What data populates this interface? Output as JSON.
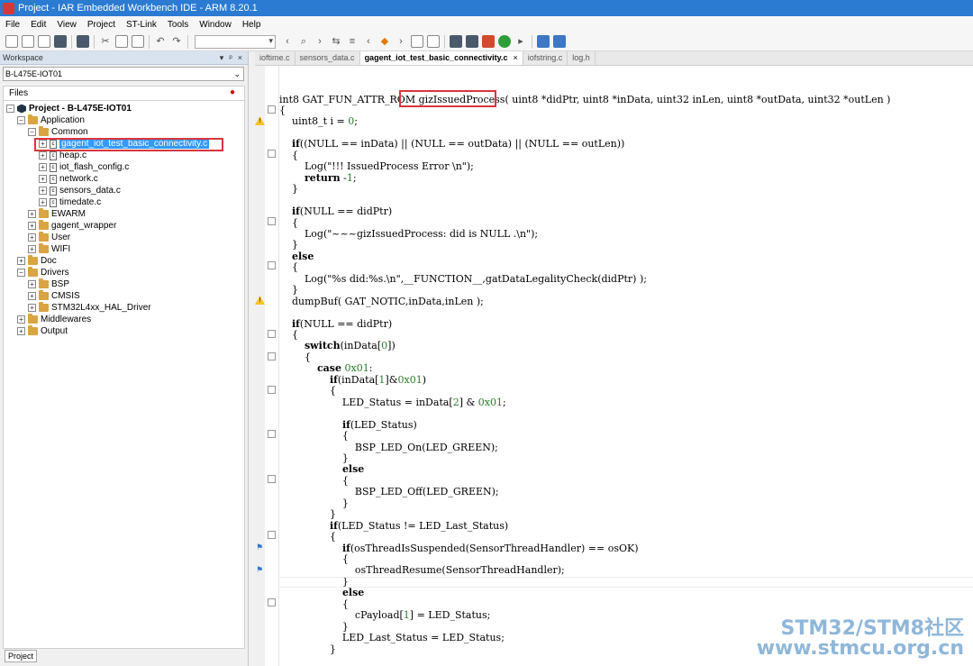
{
  "window": {
    "title": "Project - IAR Embedded Workbench IDE - ARM 8.20.1"
  },
  "menu": [
    "File",
    "Edit",
    "View",
    "Project",
    "ST-Link",
    "Tools",
    "Window",
    "Help"
  ],
  "workspace": {
    "header": "Workspace",
    "header_controls": [
      "▾",
      "ᵖ",
      "×"
    ],
    "config": "B-L475E-IOT01",
    "files_label": "Files",
    "tab": "Project",
    "tree": {
      "project": "Project - B-L475E-IOT01",
      "application": "Application",
      "common": "Common",
      "files": [
        "gagent_iot_test_basic_connectivity.c",
        "heap.c",
        "iot_flash_config.c",
        "network.c",
        "sensors_data.c",
        "timedate.c"
      ],
      "groups": [
        "EWARM",
        "gagent_wrapper",
        "User",
        "WIFI"
      ],
      "doc": "Doc",
      "drivers": "Drivers",
      "driver_groups": [
        "BSP",
        "CMSIS",
        "STM32L4xx_HAL_Driver"
      ],
      "middlewares": "Middlewares",
      "output": "Output"
    }
  },
  "editor": {
    "tabs": [
      "ioftime.c",
      "sensors_data.c",
      "gagent_iot_test_basic_connectivity.c",
      "iofstring.c",
      "log.h"
    ],
    "active_tab": "gagent_iot_test_basic_connectivity.c",
    "close": "×",
    "sig_pre": "int8 GAT_FUN_ATTR_ROM ",
    "sig_func": "gizIssuedProcess",
    "sig_post": "( uint8 *didPtr, uint8 *inData, uint32 inLen, uint8 *outData, uint32 *outLen )",
    "lines": [
      "{",
      "    uint8_t i = 0;",
      "",
      "    if((NULL == inData) || (NULL == outData) || (NULL == outLen))",
      "    {",
      "        Log(\"!!! IssuedProcess Error \\n\");",
      "        return -1;",
      "    }",
      "",
      "    if(NULL == didPtr)",
      "    {",
      "        Log(\"~~~gizIssuedProcess: did is NULL .\\n\");",
      "    }",
      "    else",
      "    {",
      "        Log(\"%s did:%s.\\n\",__FUNCTION__,gatDataLegalityCheck(didPtr) );",
      "    }",
      "    dumpBuf( GAT_NOTIC,inData,inLen );",
      "",
      "    if(NULL == didPtr)",
      "    {",
      "        switch(inData[0])",
      "        {",
      "            case 0x01:",
      "                if(inData[1]&0x01)",
      "                {",
      "                    LED_Status = inData[2] & 0x01;",
      "",
      "                    if(LED_Status)",
      "                    {",
      "                        BSP_LED_On(LED_GREEN);",
      "                    }",
      "                    else",
      "                    {",
      "                        BSP_LED_Off(LED_GREEN);",
      "                    }",
      "                }",
      "                if(LED_Status != LED_Last_Status)",
      "                {",
      "                    if(osThreadIsSuspended(SensorThreadHandler) == osOK)",
      "                    {",
      "                        osThreadResume(SensorThreadHandler);",
      "                    }",
      "                    else",
      "                    {",
      "                        cPayload[1] = LED_Status;",
      "                    }",
      "                    LED_Last_Status = LED_Status;",
      "                }"
    ]
  },
  "watermark": {
    "line1": "STM32/STM8社区",
    "line2": "www.stmcu.org.cn"
  }
}
